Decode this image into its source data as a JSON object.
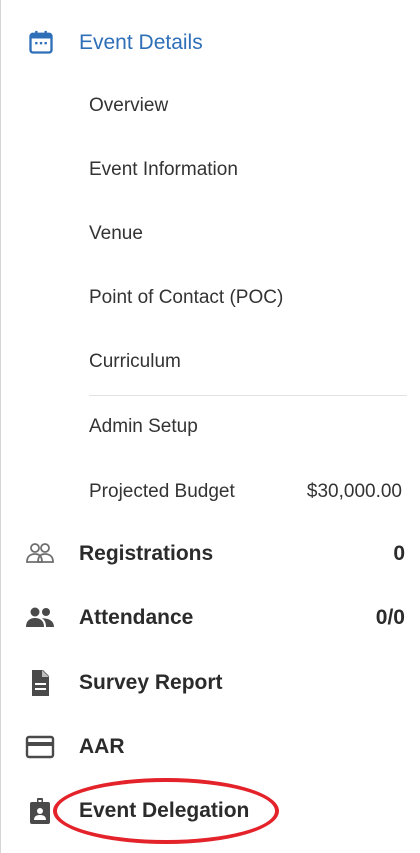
{
  "event_details": {
    "label": "Event Details",
    "icon": "calendar-icon",
    "accent_color": "#2f6fb8",
    "sub_items": [
      {
        "label": "Overview"
      },
      {
        "label": "Event Information"
      },
      {
        "label": "Venue"
      },
      {
        "label": "Point of Contact (POC)"
      },
      {
        "label": "Curriculum"
      },
      {
        "label": "Admin Setup"
      },
      {
        "label": "Projected Budget",
        "value": "$30,000.00"
      }
    ]
  },
  "main_items": [
    {
      "label": "Registrations",
      "icon": "people-outline-icon",
      "value": "0"
    },
    {
      "label": "Attendance",
      "icon": "people-icon",
      "value": "0/0"
    },
    {
      "label": "Survey Report",
      "icon": "document-icon"
    },
    {
      "label": "AAR",
      "icon": "card-icon"
    },
    {
      "label": "Event Delegation",
      "icon": "badge-icon"
    }
  ],
  "annotation_color": "#e4222a"
}
